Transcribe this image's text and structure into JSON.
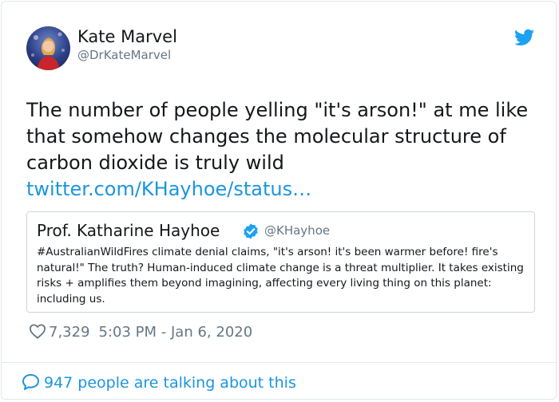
{
  "author": {
    "name": "Kate Marvel",
    "handle": "@DrKateMarvel"
  },
  "tweet": {
    "text": "The number of people yelling \"it's arson!\" at me like that somehow changes the molecular structure of carbon dioxide is truly wild",
    "link": "twitter.com/KHayhoe/status…"
  },
  "quoted": {
    "name": "Prof. Katharine Hayhoe",
    "handle": "@KHayhoe",
    "text": "#AustralianWildFires climate denial claims, \"it's arson! it's been warmer before! fire's natural!\" The truth? Human-induced climate change is a threat multiplier. It takes existing risks + amplifies them beyond imagining, affecting every living thing on this planet: including us."
  },
  "meta": {
    "likes": "7,329",
    "timestamp": "5:03 PM - Jan 6, 2020"
  },
  "footer": {
    "talking": "947 people are talking about this"
  },
  "colors": {
    "accent": "#1b95e0",
    "muted": "#657786",
    "text": "#14171a",
    "border": "#e1e8ed"
  },
  "icons": [
    "twitter-bird-icon",
    "verified-badge-icon",
    "heart-icon",
    "chat-bubble-icon"
  ]
}
